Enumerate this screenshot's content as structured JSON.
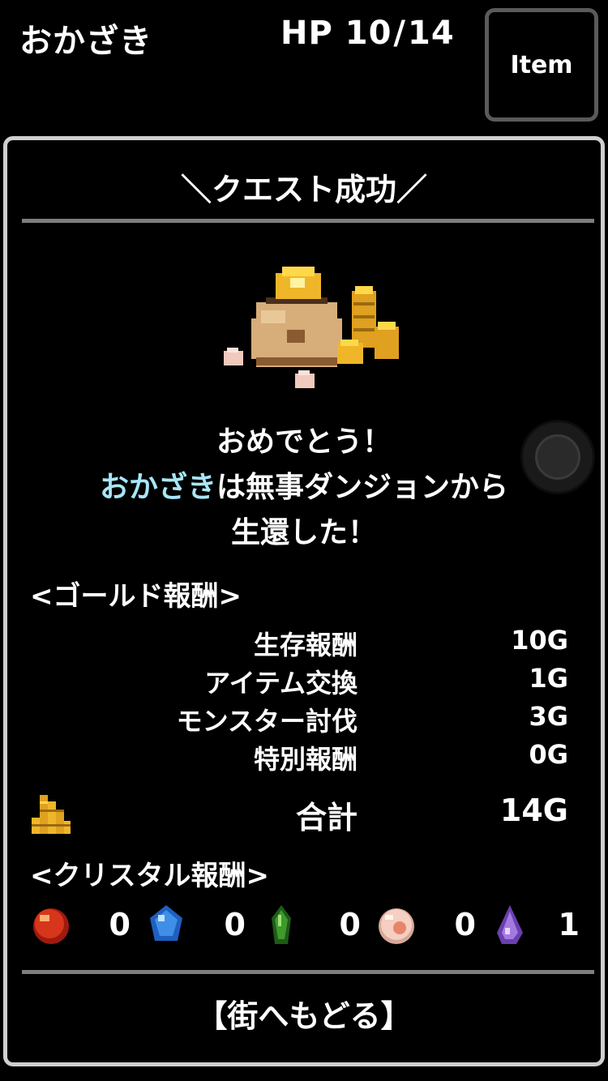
{
  "header": {
    "player_name": "おかざき",
    "hp_label": "HP",
    "hp_current": "10",
    "hp_max": "14",
    "item_button": "Item"
  },
  "panel": {
    "title": "＼クエスト成功／",
    "message": {
      "line1": "おめでとう！",
      "line2_name": "おかざき",
      "line2_rest": "は無事ダンジョンから",
      "line3": "生還した！"
    },
    "gold_section": {
      "title": "<ゴールド報酬>",
      "rows": [
        {
          "label": "生存報酬",
          "value": "10G"
        },
        {
          "label": "アイテム交換",
          "value": "1G"
        },
        {
          "label": "モンスター討伐",
          "value": "3G"
        },
        {
          "label": "特別報酬",
          "value": "0G"
        }
      ],
      "total_label": "合計",
      "total_value": "14G"
    },
    "crystal_section": {
      "title": "<クリスタル報酬>",
      "crystals": [
        {
          "icon": "red-crystal-icon",
          "count": "0",
          "color": "#d8361c"
        },
        {
          "icon": "blue-crystal-icon",
          "count": "0",
          "color": "#3f8fe6"
        },
        {
          "icon": "green-crystal-icon",
          "count": "0",
          "color": "#3d9a2b"
        },
        {
          "icon": "pink-crystal-icon",
          "count": "0",
          "color": "#f4cfc2"
        },
        {
          "icon": "purple-crystal-icon",
          "count": "1",
          "color": "#a57ae0"
        }
      ]
    },
    "return_button": "【街へもどる】"
  },
  "colors": {
    "highlight_name": "#a8e6f8",
    "panel_border": "#cfcfcf",
    "divider": "#7e7e7e",
    "gold": "#e8b22a"
  }
}
